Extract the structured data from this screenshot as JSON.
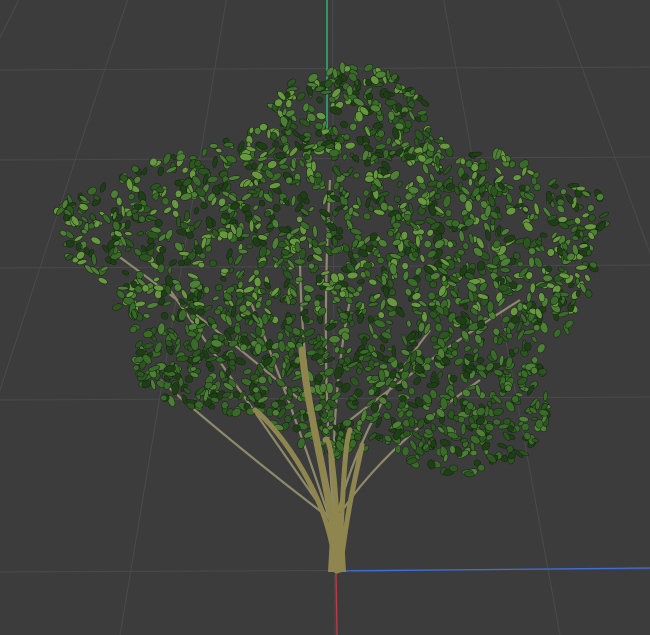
{
  "viewport": {
    "background": "#3c3c3c",
    "grid_color": "#4a4a4a",
    "object": "tree-model",
    "axes": {
      "x_axis_color": "#3f6fd8",
      "y_axis_color": "#2fbf7f",
      "z_axis_color": "#c0394a"
    },
    "tree": {
      "trunk_color": "#8f864f",
      "branch_color": "#8d8a6b",
      "leaf_colors": [
        "#1f3e17",
        "#2c5521",
        "#3a6a2a",
        "#4e7f36",
        "#67983f"
      ]
    }
  }
}
